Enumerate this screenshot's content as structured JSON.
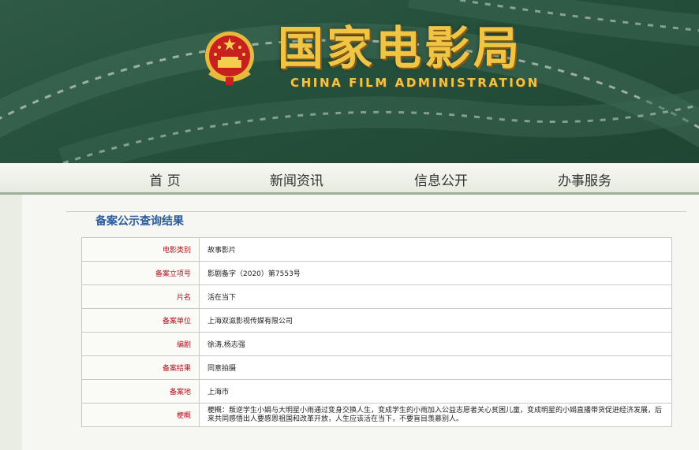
{
  "header": {
    "title_cn": "国家电影局",
    "title_en": "CHINA FILM ADMINISTRATION"
  },
  "nav": {
    "items": [
      "首 页",
      "新闻资讯",
      "信息公开",
      "办事服务"
    ]
  },
  "section": {
    "title": "备案公示查询结果"
  },
  "record": {
    "rows": [
      {
        "label": "电影类别",
        "value": "故事影片"
      },
      {
        "label": "备案立项号",
        "value": "影剧备字（2020）第7553号"
      },
      {
        "label": "片名",
        "value": "活在当下"
      },
      {
        "label": "备案单位",
        "value": "上海双滋影视传媒有限公司"
      },
      {
        "label": "编剧",
        "value": "徐涛,杨志强"
      },
      {
        "label": "备案结果",
        "value": "同意拍摄"
      },
      {
        "label": "备案地",
        "value": "上海市"
      },
      {
        "label": "梗概",
        "value": "梗概：叛逆学生小娟与大明星小雨通过变身交换人生，变成学生的小雨加入公益志愿者关心贫困儿童，变成明星的小娟直播带货促进经济发展，后来共同感悟出人要感恩祖国和改革开放，人生应该活在当下，不要盲目羡慕别人。"
      }
    ]
  },
  "colors": {
    "banner_green": "#25503c",
    "title_gold": "#f0c545",
    "label_red": "#b3111a",
    "section_blue": "#2a5d9f"
  }
}
